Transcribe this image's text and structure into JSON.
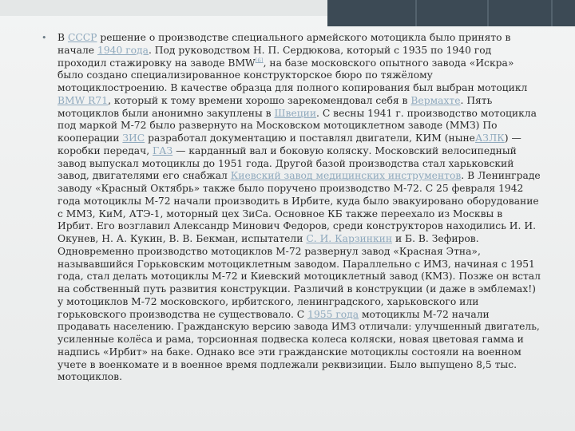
{
  "bullet": "•",
  "segments": [
    {
      "t": "В "
    },
    {
      "t": "СССР",
      "link": true
    },
    {
      "t": " решение о производстве специального армейского мотоцикла было принято в начале "
    },
    {
      "t": "1940 года",
      "link": true
    },
    {
      "t": ". Под руководством Н. П. Сердюкова, который с 1935 по 1940 год проходил стажировку на заводе BMW"
    },
    {
      "t": "[6]",
      "link": true,
      "sup": true
    },
    {
      "t": ", на базе московского опытного завода «Искра» было создано специализированное конструкторское бюро по тяжёлому мотоциклостроению. В качестве образца для полного копирования был выбран мотоцикл "
    },
    {
      "t": "BMW R71",
      "link": true
    },
    {
      "t": ", который к тому времени хорошо зарекомендовал себя в "
    },
    {
      "t": "Вермахте",
      "link": true
    },
    {
      "t": ". Пять мотоциклов были анонимно закуплены в "
    },
    {
      "t": "Швеции",
      "link": true
    },
    {
      "t": ". С весны 1941 г. производство мотоцикла под маркой М-72 было развернуто на Московском мотоциклетном заводе (ММЗ) По кооперации "
    },
    {
      "t": "ЗИС",
      "link": true
    },
    {
      "t": " разработал документацию и поставлял двигатели, КИМ (ныне"
    },
    {
      "t": "АЗЛК",
      "link": true
    },
    {
      "t": ") — коробки передач, "
    },
    {
      "t": "ГАЗ",
      "link": true
    },
    {
      "t": " — карданный вал и боковую коляску. Московский велосипедный завод выпускал мотоциклы до 1951 года. Другой базой производства стал харьковский завод, двигателями его снабжал "
    },
    {
      "t": "Киевский завод медицинских инструментов",
      "link": true
    },
    {
      "t": ". В Ленинграде заводу «Красный Октябрь» также было поручено производство М-72. С 25 февраля 1942 года мотоциклы М-72 начали производить в Ирбите, куда было эвакуировано оборудование с ММЗ, КиМ, АТЭ-1, моторный цех ЗиСа. Основное КБ также переехало из Москвы в Ирбит. Его возглавил Александр Минович Федоров, среди конструкторов находились И. И. Окунев, Н. А. Кукин, В. В. Бекман, испытатели "
    },
    {
      "t": "С. И. Карзинкин",
      "link": true
    },
    {
      "t": " и Б. В. Зефиров. Одновременно производство мотоциклов М-72 развернул завод «Красная Этна», называвшийся Горьковским мотоциклетным заводом. Параллельно с ИМЗ, начиная с 1951 года, стал делать мотоциклы М-72 и Киевский мотоциклетный завод (КМЗ). Позже он встал на собственный путь развития конструкции. Различий в конструкции (и даже в эмблемах!) у мотоциклов М-72 московского, ирбитского, ленинградского, харьковского или горьковского производства не существовало. С "
    },
    {
      "t": "1955 года",
      "link": true
    },
    {
      "t": " мотоциклы М-72 начали продавать населению. Гражданскую версию завода ИМЗ отличали: улучшенный двигатель, усиленные колёса и рама, торсионная подвеска колеса коляски, новая цветовая гамма и надпись «Ирбит» на баке. Однако все эти гражданские мотоциклы состояли на военном учете в военкомате и в военное время подлежали реквизиции. Было выпущено 8,5 тыс. мотоциклов."
    }
  ]
}
